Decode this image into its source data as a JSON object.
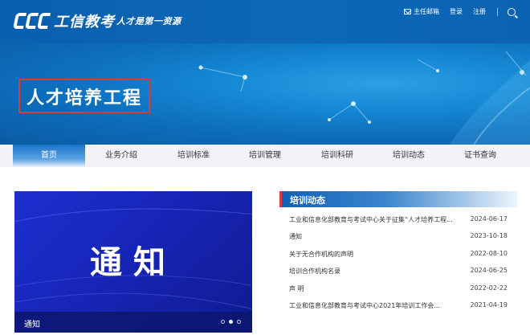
{
  "header": {
    "logo_text": "工信教考",
    "slogan": "人才是第一资源",
    "links": {
      "mail": "主任邮箱",
      "login": "登录",
      "register": "注册"
    }
  },
  "banner": {
    "title": "人才培养工程"
  },
  "nav": {
    "items": [
      {
        "label": "首页"
      },
      {
        "label": "业务介绍"
      },
      {
        "label": "培训标准"
      },
      {
        "label": "培训管理"
      },
      {
        "label": "培训科研"
      },
      {
        "label": "培训动态"
      },
      {
        "label": "证书查询"
      }
    ],
    "active_index": 0
  },
  "notice_card": {
    "big_text": "通知",
    "caption": "通知",
    "slides": 3,
    "active_slide": 2
  },
  "news": {
    "title": "培训动态",
    "items": [
      {
        "text": "工业和信息化部教育与考试中心关于征集“人才培养工程...",
        "date": "2024-06-17"
      },
      {
        "text": "通知",
        "date": "2023-10-18"
      },
      {
        "text": "关于无合作机构的声明",
        "date": "2022-08-10"
      },
      {
        "text": "培训合作机构名录",
        "date": "2024-06-25"
      },
      {
        "text": "声 明",
        "date": "2022-02-22"
      },
      {
        "text": "工业和信息化部教育与考试中心2021年培训工作会...",
        "date": "2021-04-19"
      }
    ]
  },
  "colors": {
    "brand_blue": "#0d68b8",
    "accent_red": "#d63b3b",
    "notice_blue": "#1c2fd0"
  }
}
